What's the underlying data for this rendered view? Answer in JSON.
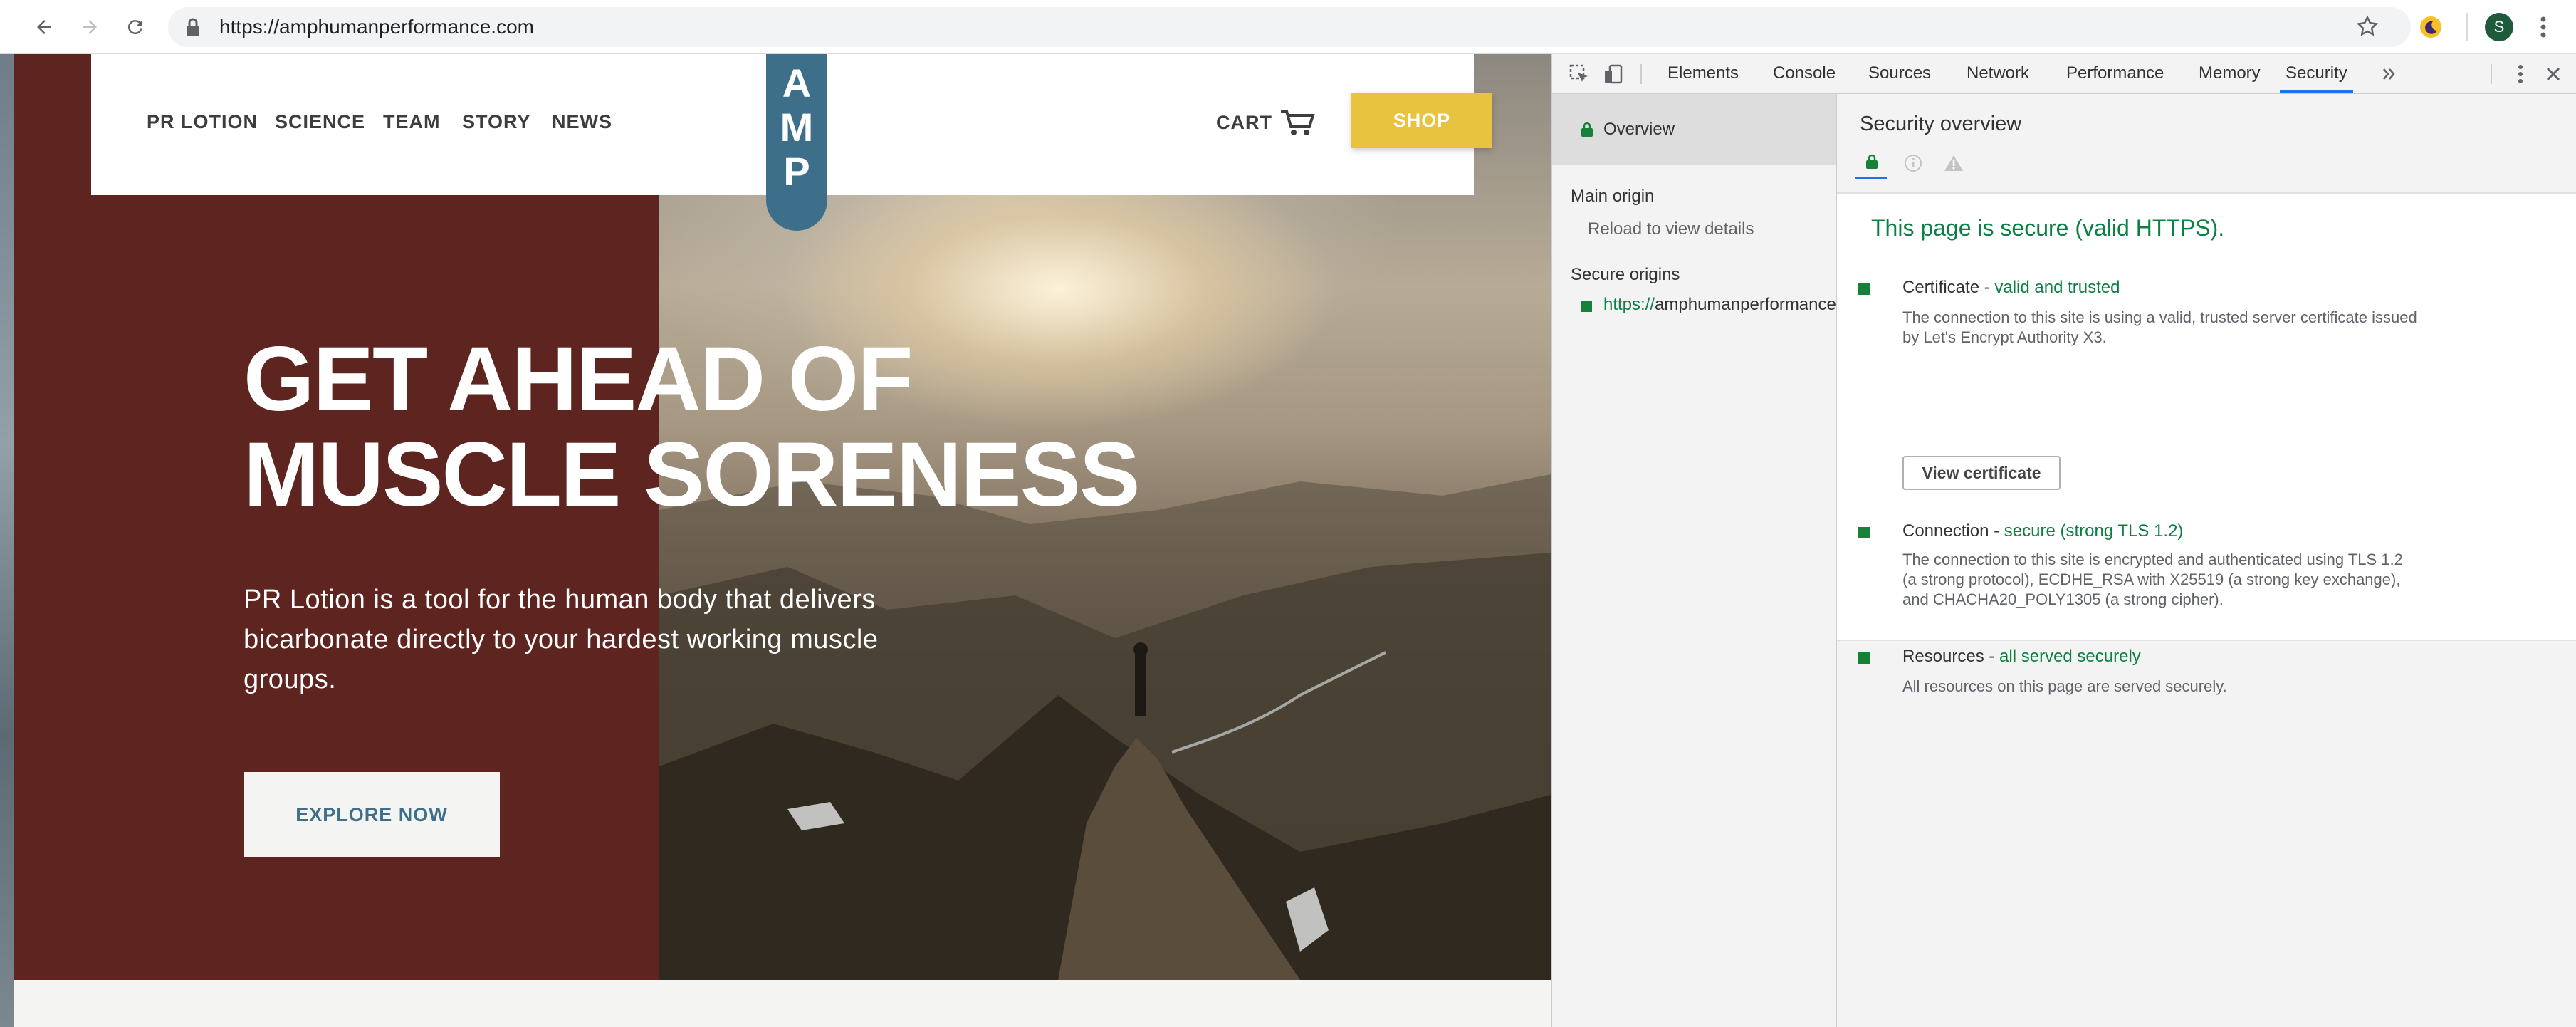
{
  "browser": {
    "url": "https://amphumanperformance.com",
    "profile_initial": "S"
  },
  "site": {
    "nav_items": [
      "PR LOTION",
      "SCIENCE",
      "TEAM",
      "STORY",
      "NEWS"
    ],
    "logo_letters": [
      "A",
      "M",
      "P"
    ],
    "cart_label": "CART",
    "shop_label": "SHOP",
    "headline_line1": "GET AHEAD OF",
    "headline_line2": "MUSCLE SORENESS",
    "subtext": "PR Lotion is a tool for the human body that delivers bicarbonate directly to your hardest working muscle groups.",
    "cta_label": "EXPLORE NOW",
    "colors": {
      "maroon": "#5e2420",
      "blue": "#3d6f8b",
      "gold": "#e8c33f"
    }
  },
  "devtools": {
    "tabs": [
      "Elements",
      "Console",
      "Sources",
      "Network",
      "Performance",
      "Memory",
      "Security"
    ],
    "active_tab": "Security",
    "sidebar": {
      "overview": "Overview",
      "main_origin": "Main origin",
      "reload_hint": "Reload to view details",
      "secure_origins": "Secure origins",
      "origin_scheme": "https://",
      "origin_host": "amphumanperformance"
    },
    "main": {
      "title": "Security overview",
      "summary": "This page is secure (valid HTTPS).",
      "certificate": {
        "label": "Certificate - ",
        "status": "valid and trusted",
        "desc_line1": "The connection to this site is using a valid, trusted server certificate issued",
        "desc_line2": "by Let's Encrypt Authority X3.",
        "button": "View certificate"
      },
      "connection": {
        "label": "Connection - ",
        "status": "secure (strong TLS 1.2)",
        "desc_line1": "The connection to this site is encrypted and authenticated using TLS 1.2",
        "desc_line2": "(a strong protocol), ECDHE_RSA with X25519 (a strong key exchange),",
        "desc_line3": "and CHACHA20_POLY1305 (a strong cipher)."
      },
      "resources": {
        "label": "Resources - ",
        "status": "all served securely",
        "desc": "All resources on this page are served securely."
      }
    }
  }
}
